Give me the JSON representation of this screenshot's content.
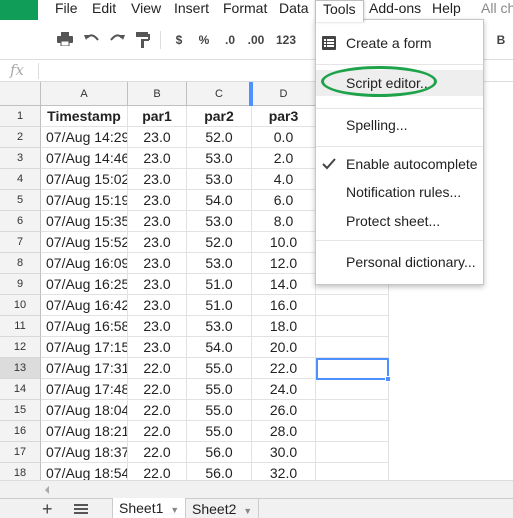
{
  "colors": {
    "brand_green": "#0f9d58",
    "selection_blue": "#4d90fe",
    "annotation_green": "#1fa34a"
  },
  "menubar": {
    "items": [
      {
        "label": "File"
      },
      {
        "label": "Edit"
      },
      {
        "label": "View"
      },
      {
        "label": "Insert"
      },
      {
        "label": "Format"
      },
      {
        "label": "Data"
      },
      {
        "label": "Tools"
      },
      {
        "label": "Add-ons"
      },
      {
        "label": "Help"
      }
    ],
    "active": "Tools",
    "status_text": "All ch"
  },
  "toolbar": {
    "print_icon": "print-icon",
    "undo_icon": "undo-icon",
    "redo_icon": "redo-icon",
    "paint_format_icon": "paint-format-icon",
    "currency_label": "$",
    "percent_label": "%",
    "decrease_decimals_label": ".0",
    "increase_decimals_label": ".00",
    "more_formats_label": "123",
    "bold_label": "B"
  },
  "formula_bar": {
    "icon_label": "fx",
    "value": ""
  },
  "grid": {
    "columns": [
      "A",
      "B",
      "C",
      "D"
    ],
    "rows": [
      {
        "n": "1",
        "cells": [
          "Timestamp",
          "par1",
          "par2",
          "par3"
        ]
      },
      {
        "n": "2",
        "cells": [
          "07/Aug 14:29",
          "23.0",
          "52.0",
          "0.0"
        ]
      },
      {
        "n": "3",
        "cells": [
          "07/Aug 14:46",
          "23.0",
          "53.0",
          "2.0"
        ]
      },
      {
        "n": "4",
        "cells": [
          "07/Aug 15:02",
          "23.0",
          "53.0",
          "4.0"
        ]
      },
      {
        "n": "5",
        "cells": [
          "07/Aug 15:19",
          "23.0",
          "54.0",
          "6.0"
        ]
      },
      {
        "n": "6",
        "cells": [
          "07/Aug 15:35",
          "23.0",
          "53.0",
          "8.0"
        ]
      },
      {
        "n": "7",
        "cells": [
          "07/Aug 15:52",
          "23.0",
          "52.0",
          "10.0"
        ]
      },
      {
        "n": "8",
        "cells": [
          "07/Aug 16:09",
          "23.0",
          "53.0",
          "12.0"
        ]
      },
      {
        "n": "9",
        "cells": [
          "07/Aug 16:25",
          "23.0",
          "51.0",
          "14.0"
        ]
      },
      {
        "n": "10",
        "cells": [
          "07/Aug 16:42",
          "23.0",
          "51.0",
          "16.0"
        ]
      },
      {
        "n": "11",
        "cells": [
          "07/Aug 16:58",
          "23.0",
          "53.0",
          "18.0"
        ]
      },
      {
        "n": "12",
        "cells": [
          "07/Aug 17:15",
          "23.0",
          "54.0",
          "20.0"
        ]
      },
      {
        "n": "13",
        "cells": [
          "07/Aug 17:31",
          "22.0",
          "55.0",
          "22.0"
        ]
      },
      {
        "n": "14",
        "cells": [
          "07/Aug 17:48",
          "22.0",
          "55.0",
          "24.0"
        ]
      },
      {
        "n": "15",
        "cells": [
          "07/Aug 18:04",
          "22.0",
          "55.0",
          "26.0"
        ]
      },
      {
        "n": "16",
        "cells": [
          "07/Aug 18:21",
          "22.0",
          "55.0",
          "28.0"
        ]
      },
      {
        "n": "17",
        "cells": [
          "07/Aug 18:37",
          "22.0",
          "56.0",
          "30.0"
        ]
      },
      {
        "n": "18",
        "cells": [
          "07/Aug 18:54",
          "22.0",
          "56.0",
          "32.0"
        ]
      }
    ],
    "selected_row": "13"
  },
  "tools_menu": {
    "items": {
      "create_form": {
        "label": "Create a form",
        "icon": "form-icon"
      },
      "script_editor": {
        "label": "Script editor..."
      },
      "spelling": {
        "label": "Spelling..."
      },
      "autocomplete": {
        "label": "Enable autocomplete",
        "checked": true
      },
      "notification_rules": {
        "label": "Notification rules..."
      },
      "protect_sheet": {
        "label": "Protect sheet..."
      },
      "personal_dictionary": {
        "label": "Personal dictionary..."
      }
    },
    "hovered": "Script editor..."
  },
  "sheets": {
    "tabs": [
      {
        "label": "Sheet1",
        "active": true
      },
      {
        "label": "Sheet2",
        "active": false
      }
    ],
    "add_icon": "plus-icon",
    "list_icon": "list-sheets-icon"
  }
}
